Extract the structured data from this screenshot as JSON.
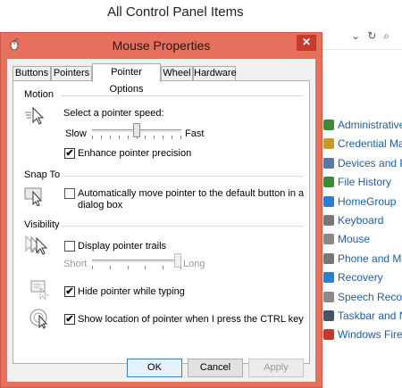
{
  "background_window": {
    "title": "All Control Panel Items",
    "items": [
      {
        "label": "Administrative T",
        "color": "#3a8b3a"
      },
      {
        "label": "Credential Mana",
        "color": "#c89a2a"
      },
      {
        "label": "Devices and Prin",
        "color": "#5577aa"
      },
      {
        "label": "File History",
        "color": "#3a8b3a"
      },
      {
        "label": "HomeGroup",
        "color": "#2a7fd0"
      },
      {
        "label": "Keyboard",
        "color": "#777777"
      },
      {
        "label": "Mouse",
        "color": "#888888"
      },
      {
        "label": "Phone and Mod",
        "color": "#777777"
      },
      {
        "label": "Recovery",
        "color": "#2a7fd0"
      },
      {
        "label": "Speech Recogni",
        "color": "#8a8a8a"
      },
      {
        "label": "Taskbar and Nav",
        "color": "#445566"
      },
      {
        "label": "Windows Firewa",
        "color": "#c0392b"
      }
    ]
  },
  "dialog": {
    "title": "Mouse Properties",
    "close_glyph": "✕",
    "tabs": [
      {
        "label": "Buttons",
        "active": false
      },
      {
        "label": "Pointers",
        "active": false
      },
      {
        "label": "Pointer Options",
        "active": true
      },
      {
        "label": "Wheel",
        "active": false
      },
      {
        "label": "Hardware",
        "active": false
      }
    ],
    "motion": {
      "group": "Motion",
      "prompt": "Select a pointer speed:",
      "slow": "Slow",
      "fast": "Fast",
      "speed_fraction": 0.5,
      "enhance_label": "Enhance pointer precision",
      "enhance_checked": true
    },
    "snap_to": {
      "group": "Snap To",
      "label_line1": "Automatically move pointer to the default button in a",
      "label_line2": "dialog box",
      "checked": false
    },
    "visibility": {
      "group": "Visibility",
      "trails_label": "Display pointer trails",
      "trails_checked": false,
      "short": "Short",
      "long": "Long",
      "trail_fraction": 1.0,
      "hide_label": "Hide pointer while typing",
      "hide_checked": true,
      "ctrl_label": "Show location of pointer when I press the CTRL key",
      "ctrl_checked": true
    },
    "buttons": {
      "ok": "OK",
      "cancel": "Cancel",
      "apply": "Apply"
    },
    "check_glyph": "✔"
  },
  "colors": {
    "frame": "#e7705c",
    "close": "#c73b2b",
    "link": "#1e5ea8"
  }
}
